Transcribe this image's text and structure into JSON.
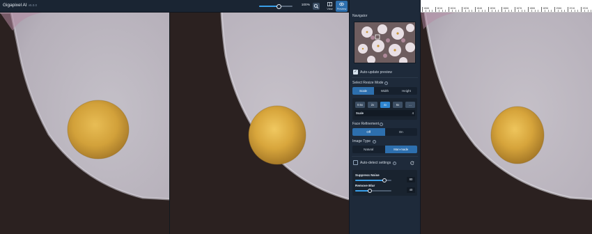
{
  "app": {
    "name": "Gigapixel AI",
    "version": "v5.0.0"
  },
  "toolbar": {
    "zoom_level": 0.6,
    "zoom_percent": "100%",
    "zoom_icon": "magnifier-icon",
    "view_label": "View",
    "preview_label": "Preview"
  },
  "ruler": {
    "labels": [
      "1800",
      "1810",
      "1820",
      "1830",
      "1840",
      "1850",
      "1860",
      "1870",
      "1880",
      "1890",
      "1900",
      "1910",
      "1920"
    ]
  },
  "panel": {
    "navigator_title": "Navigator",
    "auto_update": {
      "label": "Auto-update preview",
      "checked": true
    },
    "resize_mode": {
      "title": "Select Resize Mode",
      "options": [
        "Scale",
        "Width",
        "Height"
      ],
      "selected": "Scale"
    },
    "scale": {
      "options": [
        "0.5x",
        "2x",
        "4x",
        "6x",
        "..."
      ],
      "selected": "4x",
      "field_label": "Scale",
      "field_value": "4"
    },
    "face_refinement": {
      "title": "Face Refinement",
      "options": [
        "Off",
        "On"
      ],
      "selected": "Off"
    },
    "image_type": {
      "title": "Image Type",
      "options": [
        "Natural",
        "Man-made"
      ],
      "selected": "Man-made"
    },
    "auto_detect": {
      "label": "Auto-detect settings",
      "checked": false
    },
    "suppress_noise": {
      "label": "Suppress Noise",
      "value": "80",
      "level": 0.8
    },
    "remove_blur": {
      "label": "Remove Blur",
      "value": "40",
      "level": 0.4
    }
  },
  "colors": {
    "accent": "#2d6fae",
    "accent_bright": "#3aa0ea",
    "panel_bg": "#1e2a3a",
    "stamen": "#d9a33a",
    "petal": "#b9b3bd",
    "background_dark": "#2b2120"
  }
}
